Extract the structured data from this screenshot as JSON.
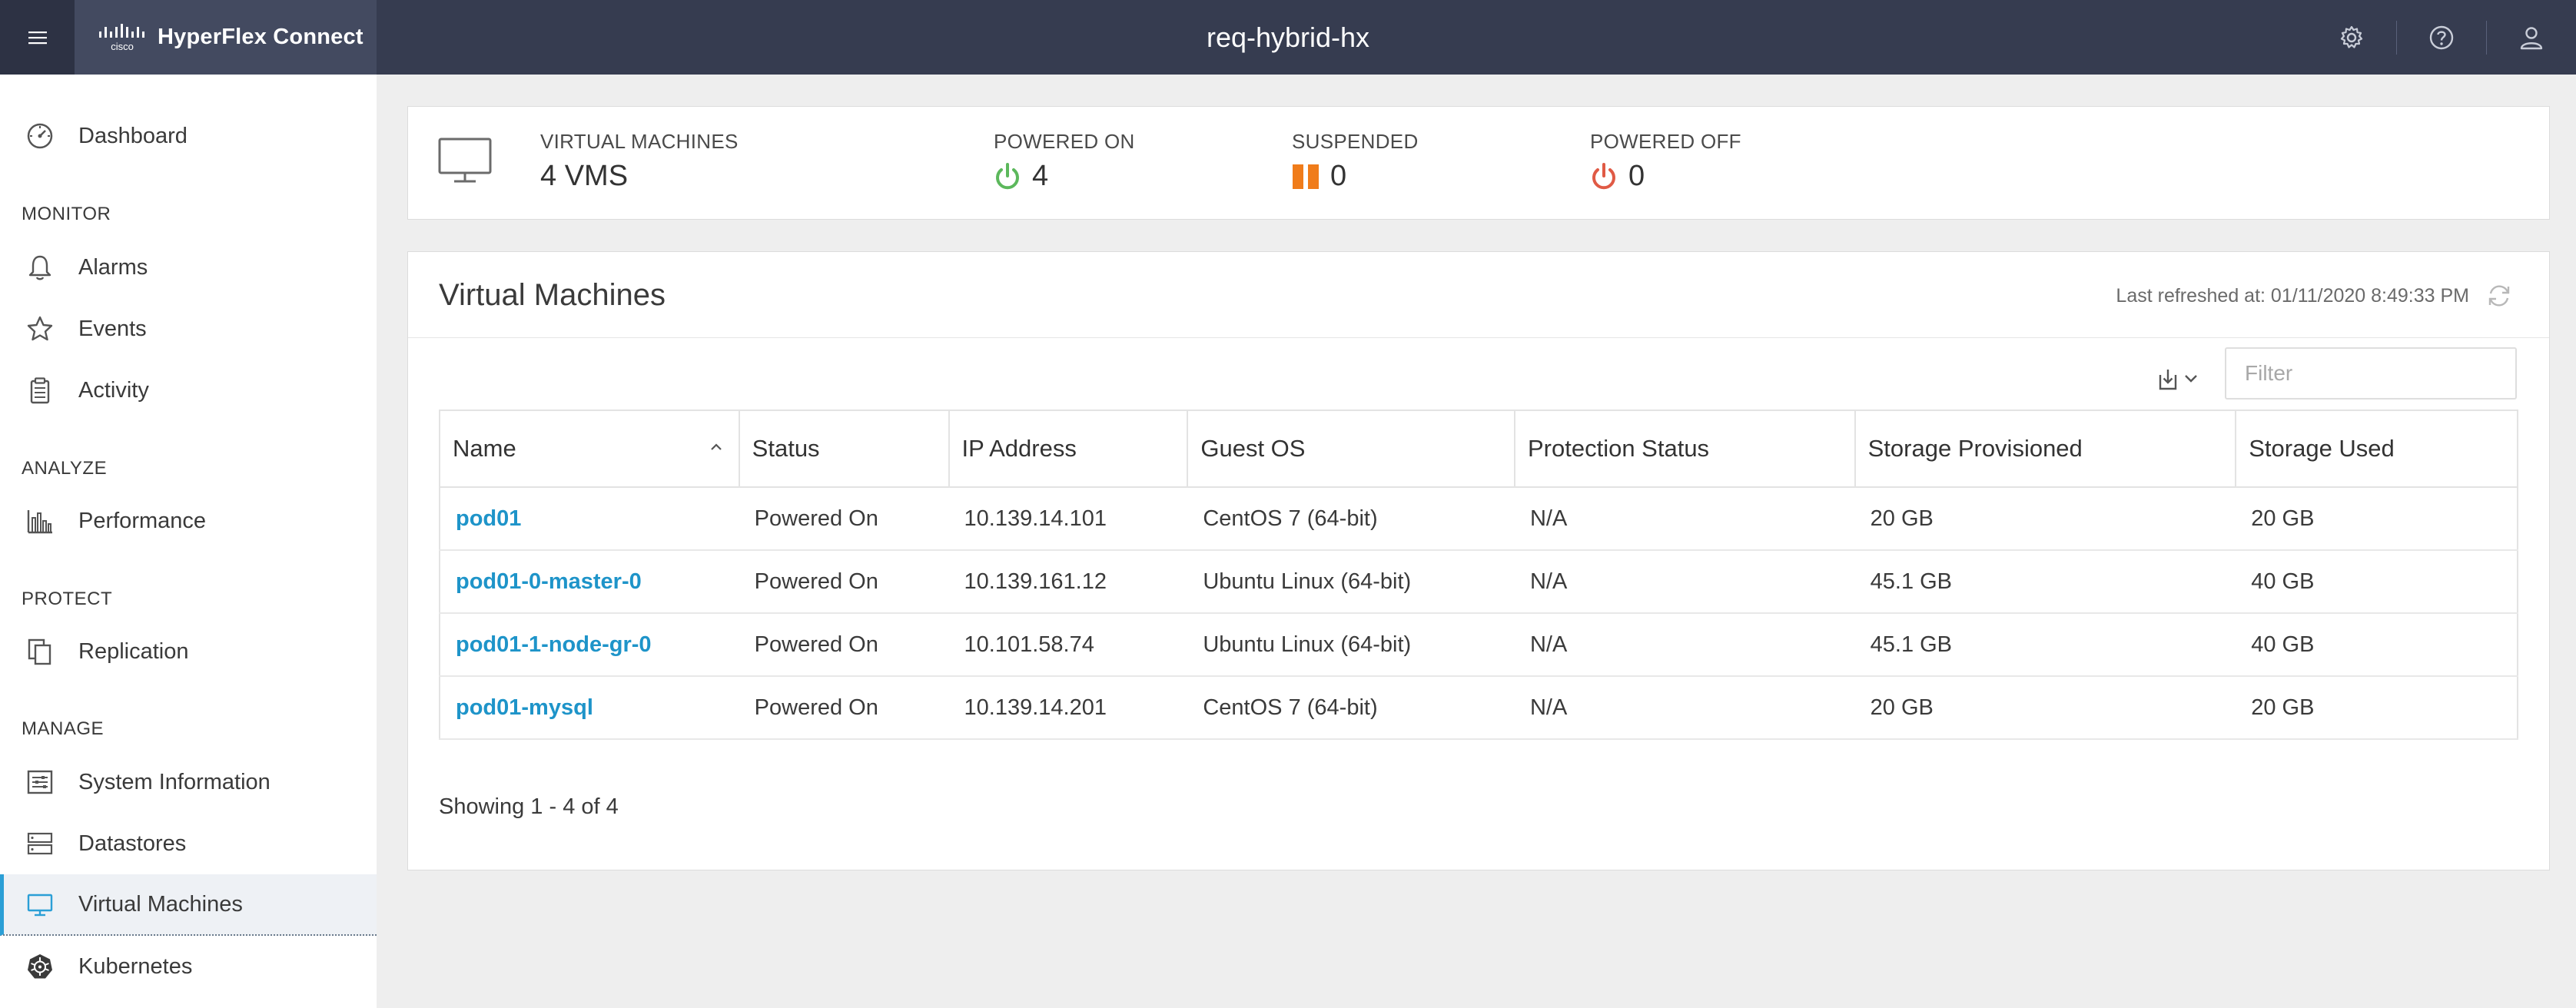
{
  "header": {
    "brand_logo": "cisco",
    "brand_name": "HyperFlex Connect",
    "cluster_name": "req-hybrid-hx",
    "icons": [
      "menu-icon",
      "settings-icon",
      "help-icon",
      "user-icon"
    ]
  },
  "sidebar": {
    "dashboard": "Dashboard",
    "sections": {
      "monitor": "MONITOR",
      "analyze": "ANALYZE",
      "protect": "PROTECT",
      "manage": "MANAGE"
    },
    "items": {
      "alarms": "Alarms",
      "events": "Events",
      "activity": "Activity",
      "performance": "Performance",
      "replication": "Replication",
      "system_information": "System Information",
      "datastores": "Datastores",
      "virtual_machines": "Virtual Machines",
      "kubernetes": "Kubernetes"
    },
    "active_item": "Virtual Machines",
    "accent_color": "#2b9fd6"
  },
  "summary": {
    "vms_label": "VIRTUAL MACHINES",
    "vms_value": "4 VMS",
    "powered_on_label": "POWERED ON",
    "powered_on_value": "4",
    "suspended_label": "SUSPENDED",
    "suspended_value": "0",
    "powered_off_label": "POWERED OFF",
    "powered_off_value": "0",
    "colors": {
      "on": "#5cb85c",
      "suspended": "#f07c1a",
      "off": "#e05a45"
    }
  },
  "panel": {
    "title": "Virtual Machines",
    "last_refreshed": "Last refreshed at: 01/11/2020 8:49:33 PM",
    "filter_placeholder": "Filter",
    "columns": [
      "Name",
      "Status",
      "IP Address",
      "Guest OS",
      "Protection Status",
      "Storage Provisioned",
      "Storage Used"
    ],
    "rows": [
      {
        "name": "pod01",
        "status": "Powered On",
        "ip": "10.139.14.101",
        "os": "CentOS 7 (64-bit)",
        "protection": "N/A",
        "provisioned": "20 GB",
        "used": "20 GB"
      },
      {
        "name": "pod01-0-master-0",
        "status": "Powered On",
        "ip": "10.139.161.12",
        "os": "Ubuntu Linux (64-bit)",
        "protection": "N/A",
        "provisioned": "45.1 GB",
        "used": "40 GB"
      },
      {
        "name": "pod01-1-node-gr-0",
        "status": "Powered On",
        "ip": "10.101.58.74",
        "os": "Ubuntu Linux (64-bit)",
        "protection": "N/A",
        "provisioned": "45.1 GB",
        "used": "40 GB"
      },
      {
        "name": "pod01-mysql",
        "status": "Powered On",
        "ip": "10.139.14.201",
        "os": "CentOS 7 (64-bit)",
        "protection": "N/A",
        "provisioned": "20 GB",
        "used": "20 GB"
      }
    ],
    "showing": "Showing 1 - 4 of 4",
    "link_color": "#1e94c9"
  }
}
